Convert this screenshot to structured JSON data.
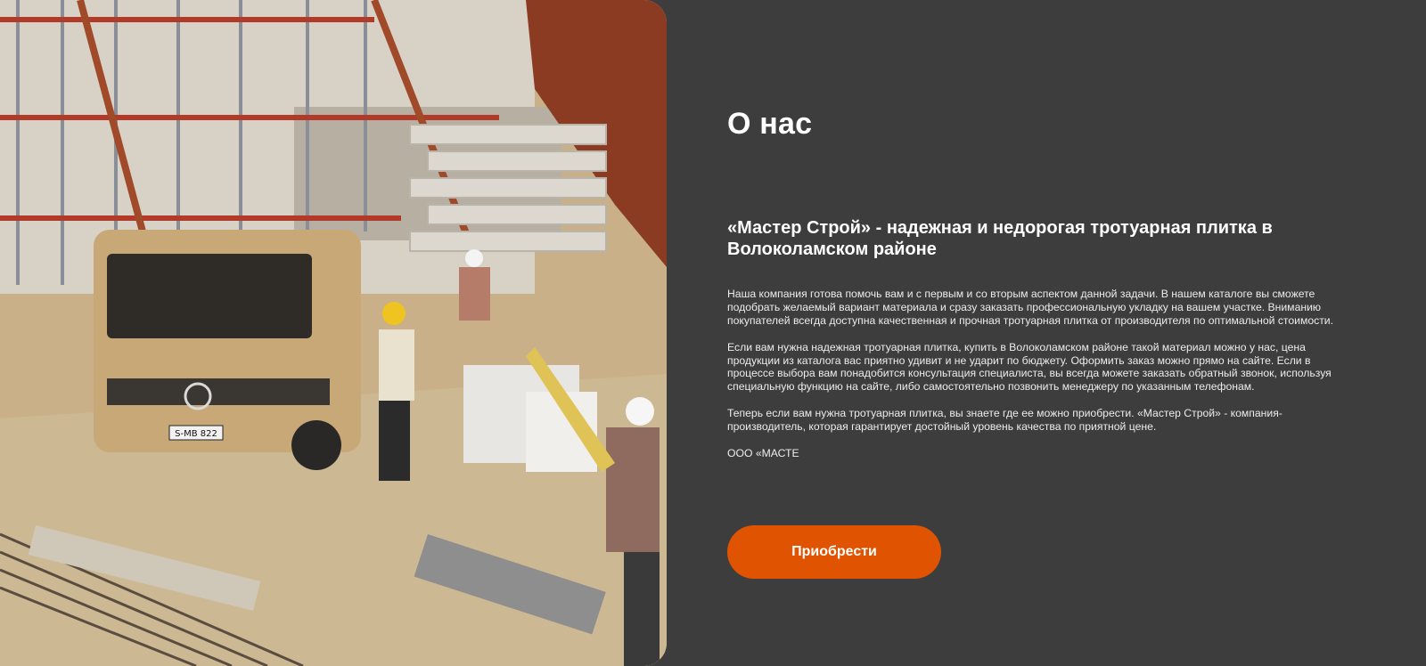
{
  "hero_image": {
    "description_icon": "construction-site-photo",
    "truck_plate": "S-MB 822"
  },
  "about": {
    "title": "О нас",
    "subtitle": "«Мастер Строй» - надежная и недорогая тротуарная плитка в Волоколамском районе",
    "paragraphs": [
      "Наша компания готова помочь вам и с первым и со вторым аспектом данной задачи. В нашем каталоге вы сможете подобрать желаемый вариант материала и сразу заказать профессиональную укладку на вашем участке. Вниманию покупателей всегда доступна качественная и прочная тротуарная плитка от производителя по оптимальной стоимости.",
      "Если вам нужна надежная тротуарная плитка, купить  в Волоколамском районе такой материал можно у нас, цена продукции из каталога вас приятно удивит и не ударит по бюджету. Оформить заказ можно прямо на сайте. Если в процессе выбора вам понадобится консультация специалиста, вы всегда можете заказать обратный звонок, используя специальную функцию на сайте, либо самостоятельно позвонить менеджеру по указанным телефонам.",
      "Теперь если вам нужна тротуарная плитка, вы знаете где ее можно приобрести. «Мастер Строй» - компания-производитель, которая гарантирует достойный уровень качества по приятной цене.",
      "ООО «МАСТЕ"
    ],
    "button_label": "Приобрести"
  },
  "colors": {
    "background": "#3d3d3d",
    "accent": "#e05300",
    "text": "#ffffff"
  }
}
